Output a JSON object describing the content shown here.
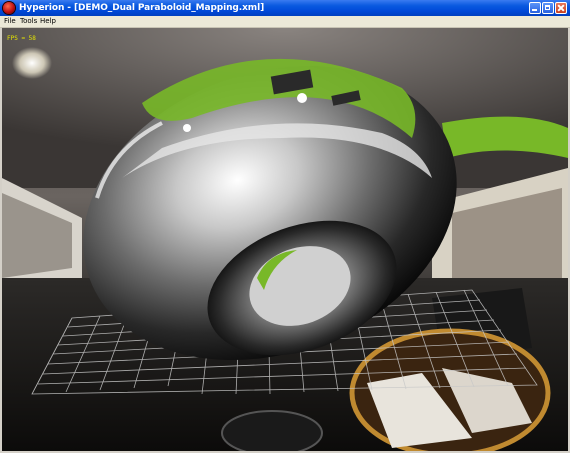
{
  "window": {
    "title": "Hyperion - [DEMO_Dual Paraboloid_Mapping.xml]",
    "icon": "hyperion-app-icon"
  },
  "menu": {
    "items": [
      "File",
      "Tools",
      "Help"
    ]
  },
  "viewport": {
    "fps_label": "FPS = 58"
  },
  "colors": {
    "titlebar": "#0a5ae0",
    "fps_text": "#e6e600",
    "green_accent": "#78b828",
    "grid": "#c8c8c8"
  }
}
